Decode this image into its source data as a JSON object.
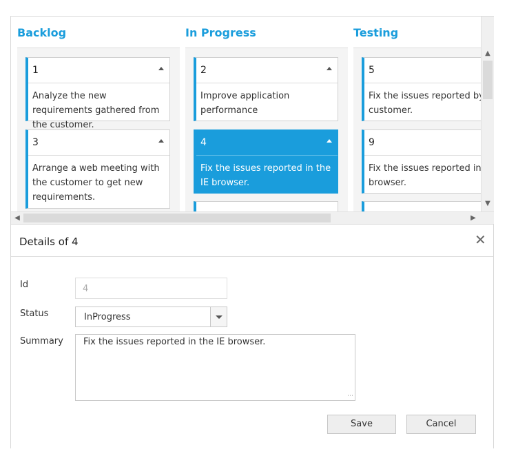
{
  "columns": [
    {
      "header": "Backlog",
      "cards": [
        {
          "id": "1",
          "summary": "Analyze the new requirements gathered from the customer."
        },
        {
          "id": "3",
          "summary": "Arrange a web meeting with the customer to get new requirements."
        }
      ]
    },
    {
      "header": "In Progress",
      "cards": [
        {
          "id": "2",
          "summary": "Improve application performance"
        },
        {
          "id": "4",
          "summary": "Fix the issues reported in the IE browser."
        }
      ]
    },
    {
      "header": "Testing",
      "cards": [
        {
          "id": "5",
          "summary": "Fix the issues reported by the customer."
        },
        {
          "id": "9",
          "summary": "Fix the issues reported in Safari browser."
        }
      ]
    }
  ],
  "selected_card_id": "4",
  "details": {
    "title": "Details of 4",
    "close_icon": "close-icon",
    "id_label": "Id",
    "id_value": "4",
    "status_label": "Status",
    "status_value": "InProgress",
    "summary_label": "Summary",
    "summary_value": "Fix the issues reported in the IE browser.",
    "save_label": "Save",
    "cancel_label": "Cancel"
  },
  "colors": {
    "accent": "#1a9ddc"
  }
}
